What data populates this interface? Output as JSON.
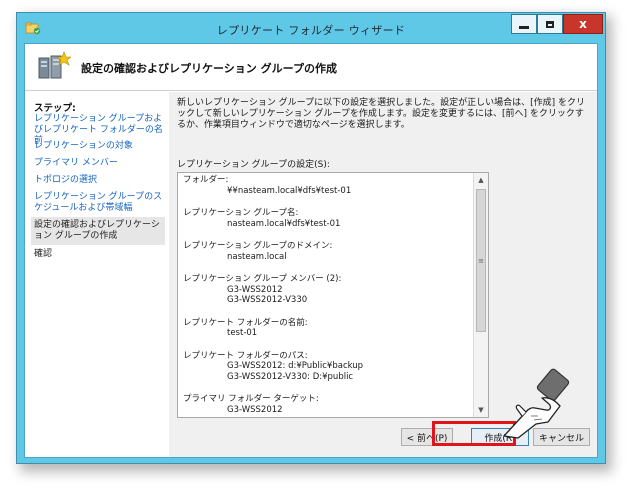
{
  "window": {
    "title": "レプリケート フォルダー ウィザード",
    "close_glyph": "x"
  },
  "header": {
    "title": "設定の確認およびレプリケーション グループの作成"
  },
  "steps": {
    "heading": "ステップ:",
    "items": [
      {
        "label": "レプリケーション グループおよびレプリケート フォルダーの名前"
      },
      {
        "label": "レプリケーションの対象"
      },
      {
        "label": "プライマリ メンバー"
      },
      {
        "label": "トポロジの選択"
      },
      {
        "label": "レプリケーション グループのスケジュールおよび帯域幅"
      },
      {
        "label": "設定の確認およびレプリケーション グループの作成"
      },
      {
        "label": "確認"
      }
    ]
  },
  "main": {
    "description": "新しいレプリケーション グループに以下の設定を選択しました。設定が正しい場合は、[作成] をクリックして新しいレプリケーション グループを作成します。設定を変更するには、[前へ] をクリックするか、作業項目ウィンドウで適切なページを選択します。",
    "settings_label": "レプリケーション グループの設定(S):",
    "settings": [
      {
        "label": "フォルダー:",
        "values": [
          "¥¥nasteam.local¥dfs¥test-01"
        ]
      },
      {
        "label": "レプリケーション グループ名:",
        "values": [
          "nasteam.local¥dfs¥test-01"
        ]
      },
      {
        "label": "レプリケーション グループのドメイン:",
        "values": [
          "nasteam.local"
        ]
      },
      {
        "label": "レプリケーション グループ メンバー (2):",
        "values": [
          "G3-WSS2012",
          "G3-WSS2012-V330"
        ]
      },
      {
        "label": "レプリケート フォルダーの名前:",
        "values": [
          "test-01"
        ]
      },
      {
        "label": "レプリケート フォルダーのパス:",
        "values": [
          "G3-WSS2012: d:¥Public¥backup",
          "G3-WSS2012-V330: D:¥public"
        ]
      },
      {
        "label": "プライマリ フォルダー ターゲット:",
        "values": [
          "G3-WSS2012"
        ]
      }
    ]
  },
  "buttons": {
    "back": "< 前へ(P)",
    "create": "作成(R)",
    "cancel": "キャンセル"
  },
  "scrollbar": {
    "up": "▲",
    "down": "▼",
    "thumb_grip": "≡"
  },
  "colors": {
    "title_bar": "#5ec8e6",
    "highlight": "#e0141b",
    "link": "#1565c0"
  }
}
